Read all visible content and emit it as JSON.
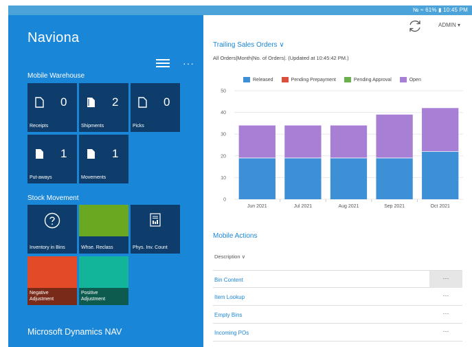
{
  "statusbar": {
    "text": "№ ≈ 61% ▮ 10:45 PM"
  },
  "app": {
    "title": "Naviona",
    "footer": "Microsoft Dynamics NAV"
  },
  "mobile_warehouse": {
    "title": "Mobile Warehouse",
    "tiles": [
      {
        "label": "Receipts",
        "count": "0"
      },
      {
        "label": "Shipments",
        "count": "2"
      },
      {
        "label": "Picks",
        "count": "0"
      },
      {
        "label": "Put-aways",
        "count": "1"
      },
      {
        "label": "Movements",
        "count": "1"
      }
    ]
  },
  "stock_movement": {
    "title": "Stock Movement",
    "tiles": [
      {
        "label": "Inventory in Bins"
      },
      {
        "label": "Whse. Reclass"
      },
      {
        "label": "Phys. Inv. Count"
      },
      {
        "label_line1": "Negative",
        "label_line2": "Adjustment"
      },
      {
        "label_line1": "Positive",
        "label_line2": "Adjustment"
      }
    ]
  },
  "header": {
    "user": "ADMIN ▾"
  },
  "chart_section": {
    "title": "Trailing Sales Orders ∨",
    "subtitle": "All Orders|Month|No. of Orders|. (Updated at 10:45:42 PM.)"
  },
  "colors": {
    "released": "#3d8fd6",
    "pending_prepayment": "#d9513d",
    "pending_approval": "#6ab04c",
    "open": "#a77fd4"
  },
  "chart_data": {
    "type": "bar",
    "stacked": true,
    "categories": [
      "Jun 2021",
      "Jul 2021",
      "Aug 2021",
      "Sep 2021",
      "Oct 2021"
    ],
    "series": [
      {
        "name": "Released",
        "values": [
          19,
          19,
          19,
          19,
          22
        ]
      },
      {
        "name": "Pending Prepayment",
        "values": [
          0,
          0,
          0,
          0,
          0
        ]
      },
      {
        "name": "Pending Approval",
        "values": [
          0,
          0,
          0,
          0,
          0
        ]
      },
      {
        "name": "Open",
        "values": [
          15,
          15,
          15,
          20,
          20
        ]
      }
    ],
    "ylim": [
      0,
      50
    ],
    "yticks": [
      0,
      10,
      20,
      30,
      40,
      50
    ],
    "legend": "top",
    "grid": true
  },
  "mobile_actions": {
    "title": "Mobile Actions",
    "column_header": "Description ∨",
    "rows": [
      {
        "label": "Bin Content"
      },
      {
        "label": "Item Lookup"
      },
      {
        "label": "Empty Bins"
      },
      {
        "label": "Incoming POs"
      }
    ],
    "more_label": "···"
  }
}
